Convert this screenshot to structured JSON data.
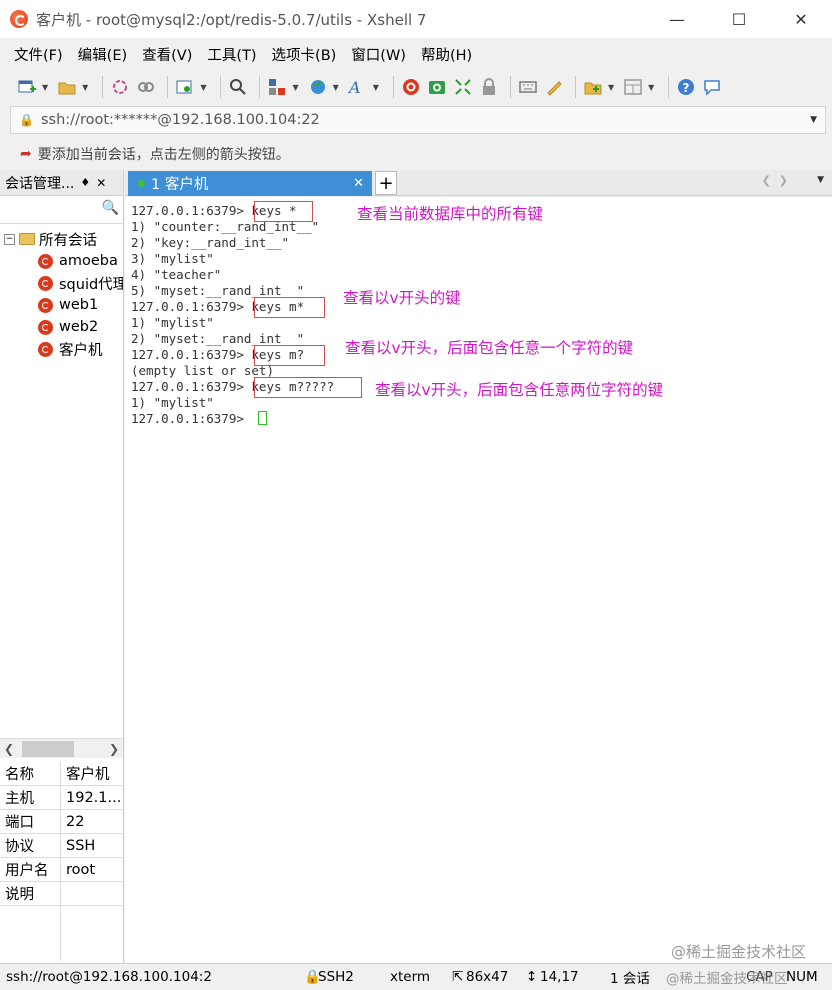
{
  "window": {
    "title": "客户机 - root@mysql2:/opt/redis-5.0.7/utils - Xshell 7",
    "controls": {
      "minimize": "—",
      "maximize": "☐",
      "close": "✕"
    }
  },
  "menu": [
    "文件(F)",
    "编辑(E)",
    "查看(V)",
    "工具(T)",
    "选项卡(B)",
    "窗口(W)",
    "帮助(H)"
  ],
  "address": {
    "value": "ssh://root:******@192.168.100.104:22"
  },
  "hint": "要添加当前会话，点击左侧的箭头按钮。",
  "left_panel": {
    "title": "会话管理...",
    "pin": "♦",
    "close": "✕",
    "tree_root": "所有会话",
    "sessions": [
      "amoeba",
      "squid代理",
      "web1",
      "web2",
      "客户机"
    ]
  },
  "properties": [
    {
      "key": "名称",
      "value": "客户机"
    },
    {
      "key": "主机",
      "value": "192.1..."
    },
    {
      "key": "端口",
      "value": "22"
    },
    {
      "key": "协议",
      "value": "SSH"
    },
    {
      "key": "用户名",
      "value": "root"
    },
    {
      "key": "说明",
      "value": ""
    }
  ],
  "tab": {
    "label": "1 客户机",
    "close": "✕",
    "add": "+"
  },
  "terminal": {
    "lines": [
      "127.0.0.1:6379> keys *",
      "1) \"counter:__rand_int__\"",
      "2) \"key:__rand_int__\"",
      "3) \"mylist\"",
      "4) \"teacher\"",
      "5) \"myset:__rand_int__\"",
      "127.0.0.1:6379> keys m*",
      "1) \"mylist\"",
      "2) \"myset:__rand_int__\"",
      "127.0.0.1:6379> keys m?",
      "(empty list or set)",
      "127.0.0.1:6379> keys m?????",
      "1) \"mylist\"",
      "127.0.0.1:6379> "
    ],
    "annotations": [
      "查看当前数据库中的所有键",
      "查看以v开头的键",
      "查看以v开头，后面包含任意一个字符的键",
      "查看以v开头，后面包含任意两位字符的键"
    ],
    "watermarks": [
      "@稀土掘金技术社区",
      "@稀土掘金技术社区"
    ]
  },
  "status": {
    "connection": "ssh://root@192.168.100.104:2",
    "protocol": "SSH2",
    "term": "xterm",
    "size": "86x47",
    "cursor_pos": "14,17",
    "sessions": "1 会话",
    "caps": "CAP",
    "num": "NUM"
  },
  "colors": {
    "annotation": "#d016c8",
    "highlight_box": "#d94a4a",
    "tab_active": "#3f8fd6",
    "cursor": "#2fbf2f"
  }
}
